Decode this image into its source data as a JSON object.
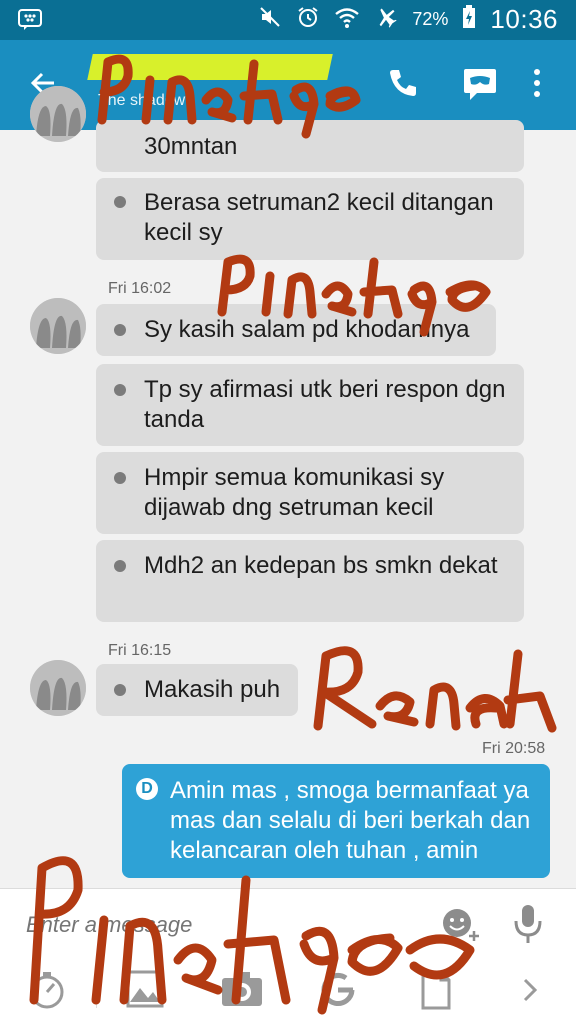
{
  "status_bar": {
    "battery_percent": "72%",
    "time": "10:36",
    "icons": [
      "bbm-icon",
      "mute-icon",
      "alarm-icon",
      "wifi-icon",
      "airplane-icon",
      "battery-icon"
    ]
  },
  "app_bar": {
    "title": "The shadow",
    "icons": [
      "back-arrow-icon",
      "phone-icon",
      "chat-mask-icon",
      "overflow-menu-icon"
    ]
  },
  "messages": {
    "group1": [
      {
        "text": "30mntan"
      },
      {
        "text": "Berasa setruman2 kecil ditangan kecil sy"
      }
    ],
    "group2": {
      "time": "Fri 16:02",
      "items": [
        {
          "text": "Sy kasih salam pd khodamnya"
        },
        {
          "text": "Tp sy afirmasi utk beri respon dgn tanda"
        },
        {
          "text": "Hmpir semua komunikasi sy dijawab dng setruman kecil"
        },
        {
          "text": "Mdh2 an kedepan bs smkn dekat"
        }
      ]
    },
    "group3": {
      "time": "Fri 16:15",
      "items": [
        {
          "text": "Makasih puh"
        }
      ]
    },
    "outgoing": {
      "time": "Fri 20:58",
      "badge": "D",
      "text": "Amin mas , smoga bermanfaat ya mas dan selalu di beri berkah dan kelancaran oleh tuhan , amin"
    }
  },
  "composer": {
    "placeholder": "Enter a message"
  },
  "toolbar_icons": [
    "timer-icon",
    "gallery-icon",
    "camera-icon",
    "refresh-g-icon",
    "file-icon",
    "chevron-right-icon"
  ],
  "watermark": {
    "words": [
      "Pinangs",
      "Pinangs",
      "Renah",
      "Pinangs"
    ],
    "color": "#b23a12"
  },
  "colors": {
    "status_bar": "#0a6f94",
    "app_bar": "#1a8ec0",
    "outgoing_bubble": "#2ea2d6",
    "incoming_bubble": "#dcdcdc"
  }
}
